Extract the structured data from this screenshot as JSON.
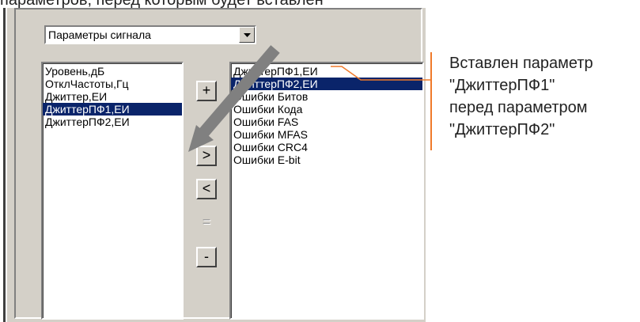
{
  "caption": {
    "text": "параметров, перед которым будет вставлен"
  },
  "combo": {
    "value": "Параметры сигнала"
  },
  "left_list": {
    "items": [
      {
        "label": "Уровень,дБ",
        "selected": false
      },
      {
        "label": "ОтклЧастоты,Гц",
        "selected": false
      },
      {
        "label": "Джиттер,ЕИ",
        "selected": false
      },
      {
        "label": "ДжиттерПФ1,ЕИ",
        "selected": true
      },
      {
        "label": "ДжиттерПФ2,ЕИ",
        "selected": false
      }
    ]
  },
  "right_list": {
    "items": [
      {
        "label": "ДжиттерПФ1,ЕИ",
        "selected": false
      },
      {
        "label": "ДжиттерПФ2,ЕИ",
        "selected": true
      },
      {
        "label": "Ошибки Битов",
        "selected": false
      },
      {
        "label": "Ошибки Кода",
        "selected": false
      },
      {
        "label": "Ошибки FAS",
        "selected": false
      },
      {
        "label": "Ошибки MFAS",
        "selected": false
      },
      {
        "label": "Ошибки CRC4",
        "selected": false
      },
      {
        "label": "Ошибки E-bit",
        "selected": false
      }
    ]
  },
  "buttons": {
    "add": "+",
    "move_right": ">",
    "move_left": "<",
    "disabled": "=",
    "remove": "-"
  },
  "annotation": {
    "lines": [
      "Вставлен параметр",
      "\"ДжиттерПФ1\"",
      "перед параметром",
      "\"ДжиттерПФ2\""
    ],
    "color": "#f07a2a"
  },
  "colors": {
    "selection": "#0a246a",
    "dialog_bg": "#d4d0c8",
    "arrow": "#808080"
  }
}
